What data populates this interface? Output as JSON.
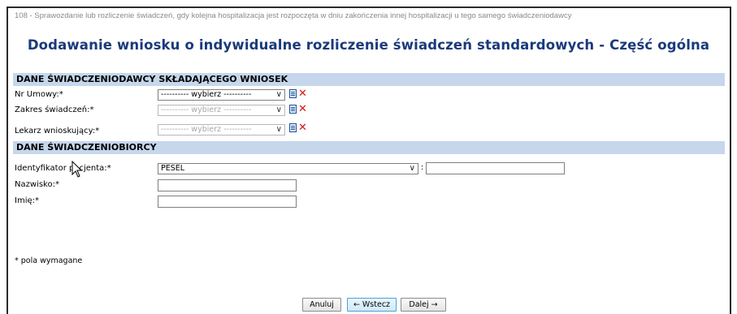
{
  "breadcrumb": "108 - Sprawozdanie lub rozliczenie świadczeń, gdy kolejna hospitalizacja jest rozpoczęta w dniu zakończenia innej hospitalizacji u tego samego świadczeniodawcy",
  "page_title": "Dodawanie wniosku o indywidualne rozliczenie świadczeń standardowych - Część ogólna",
  "section_provider": {
    "title": "DANE ŚWIADCZENIODAWCY SKŁADAJĄCEGO WNIOSEK",
    "fields": [
      {
        "label": "Nr Umowy:*",
        "value": "---------- wybierz ----------",
        "enabled": true
      },
      {
        "label": "Zakres świadczeń:*",
        "value": "---------- wybierz ----------",
        "enabled": false
      },
      {
        "label": "Lekarz wnioskujący:*",
        "value": "---------- wybierz ----------",
        "enabled": false
      }
    ]
  },
  "section_recipient": {
    "title": "DANE ŚWIADCZENIOBIORCY",
    "patient_id_label": "Identyfikator pacjenta:*",
    "patient_id_type": "PESEL",
    "patient_id_value": "",
    "surname_label": "Nazwisko:*",
    "surname_value": "",
    "name_label": "Imię:*",
    "name_value": ""
  },
  "required_note": "* pola wymagane",
  "buttons": {
    "cancel": "Anuluj",
    "back": "← Wstecz",
    "next": "Dalej →"
  },
  "icons": {
    "list": "list-icon",
    "clear": "clear-x-icon",
    "cursor": "mouse-pointer-icon",
    "chevron": "chevron-down-icon"
  },
  "colors": {
    "title": "#1a3a7a",
    "section_bar": "#c6d7ec",
    "clear_icon": "#dd1111",
    "active_button_border": "#4aa3d8"
  }
}
